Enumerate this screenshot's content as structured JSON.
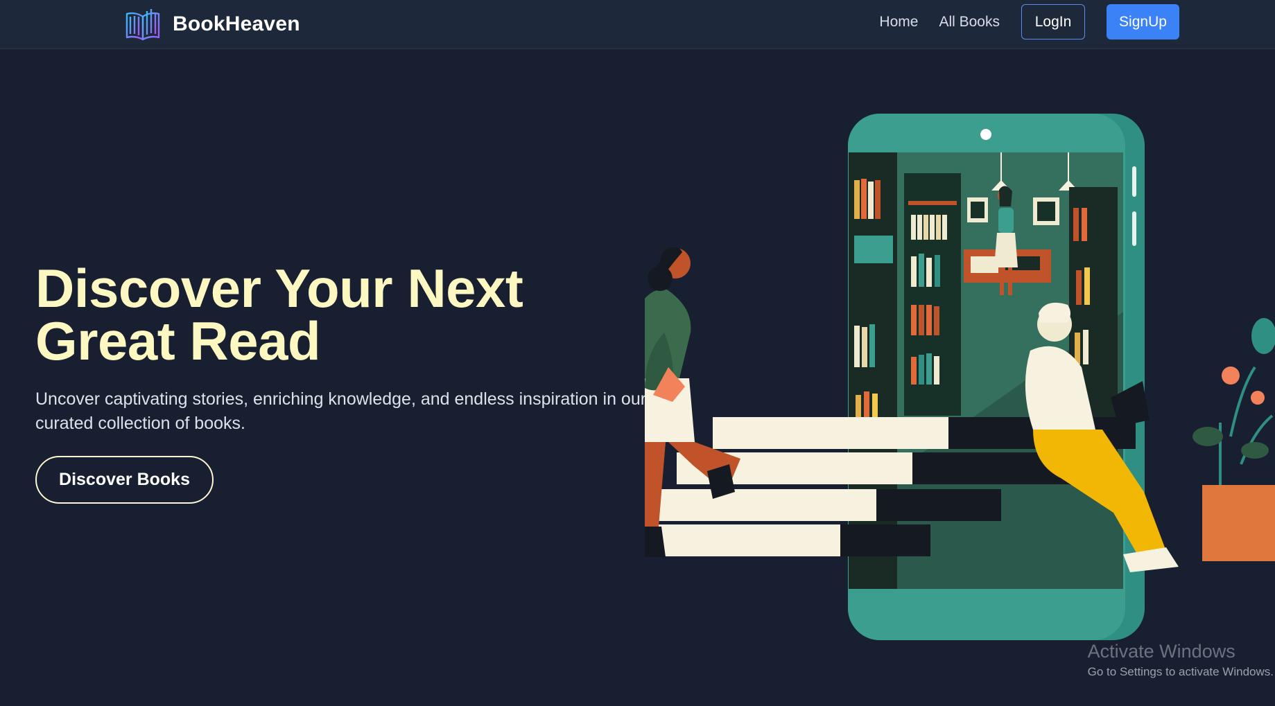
{
  "app": {
    "brand": "BookHeaven",
    "logo_icon": "open-book-icon"
  },
  "nav": {
    "home": "Home",
    "all_books": "All Books",
    "login": "LogIn",
    "signup": "SignUp"
  },
  "hero": {
    "title": "Discover Your Next Great Read",
    "subtitle": "Uncover captivating stories, enriching knowledge, and endless inspiration in our curated collection of books.",
    "cta": "Discover Books",
    "illustration": "reading-library-illustration"
  },
  "os_watermark": {
    "title": "Activate Windows",
    "subtitle": "Go to Settings to activate Windows."
  },
  "colors": {
    "background": "#181f31",
    "navbar": "#1e283b",
    "title": "#fdf7c2",
    "accent": "#3b82f6"
  }
}
